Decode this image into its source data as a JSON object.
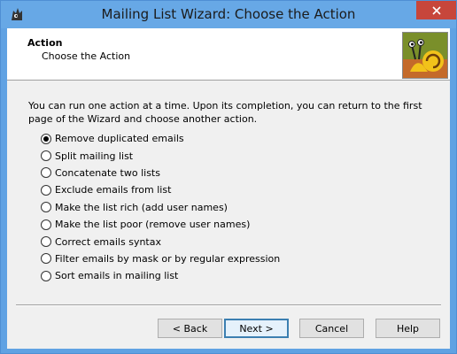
{
  "window": {
    "title": "Mailing List Wizard: Choose the Action",
    "close_icon": "close-icon",
    "app_icon": "wizard-app-icon"
  },
  "header": {
    "title": "Action",
    "subtitle": "Choose the Action",
    "image": "snail-mascot-icon"
  },
  "description": "You can run one action at a time. Upon its completion, you can return to the first page of the Wizard and choose another action.",
  "options": [
    {
      "label": "Remove duplicated emails",
      "checked": true
    },
    {
      "label": "Split mailing list",
      "checked": false
    },
    {
      "label": "Concatenate two lists",
      "checked": false
    },
    {
      "label": "Exclude emails from list",
      "checked": false
    },
    {
      "label": "Make the list rich (add user names)",
      "checked": false
    },
    {
      "label": "Make the list poor (remove user names)",
      "checked": false
    },
    {
      "label": "Correct emails syntax",
      "checked": false
    },
    {
      "label": "Filter emails by mask or by regular expression",
      "checked": false
    },
    {
      "label": "Sort emails in mailing list",
      "checked": false
    }
  ],
  "buttons": {
    "back": "< Back",
    "next": "Next >",
    "cancel": "Cancel",
    "help": "Help"
  },
  "colors": {
    "titlebar": "#67a8e6",
    "close": "#c7463b",
    "default_button_border": "#3c7fb1"
  }
}
